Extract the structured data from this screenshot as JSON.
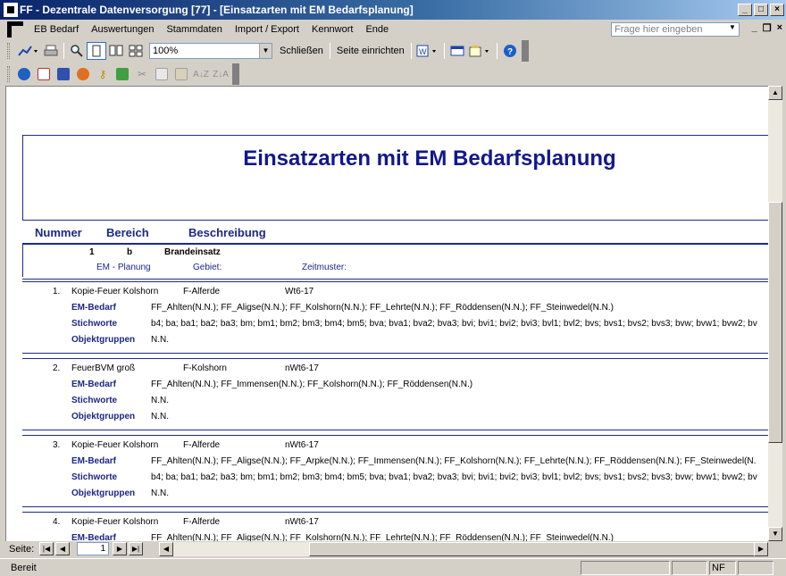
{
  "window": {
    "title": "FF - Dezentrale Datenversorgung [77] - [Einsatzarten mit EM Bedarfsplanung]",
    "controls": {
      "minimize": "_",
      "maximize": "□",
      "close": "×"
    }
  },
  "menubar": {
    "items": [
      "EB Bedarf",
      "Auswertungen",
      "Stammdaten",
      "Import / Export",
      "Kennwort",
      "Ende"
    ],
    "help_placeholder": "Frage hier eingeben",
    "mdi": {
      "minimize": "_",
      "restore": "❐",
      "close": "×"
    }
  },
  "toolbar1": {
    "zoom_value": "100%",
    "close_label": "Schließen",
    "page_setup_label": "Seite einrichten"
  },
  "report": {
    "title": "Einsatzarten mit EM Bedarfsplanung",
    "columns": {
      "nummer": "Nummer",
      "bereich": "Bereich",
      "beschreibung": "Beschreibung"
    },
    "group": {
      "nummer": "1",
      "bereich": "b",
      "beschreibung": "Brandeinsatz",
      "label_em_planung": "EM - Planung",
      "label_gebiet": "Gebiet:",
      "label_zeitmuster": "Zeitmuster:"
    },
    "labels": {
      "em_bedarf": "EM-Bedarf",
      "stichworte": "Stichworte",
      "objektgruppen": "Objektgruppen"
    },
    "entries": [
      {
        "nr": "1.",
        "name": "Kopie-Feuer Kolshorn",
        "gebiet": "F-Alferde",
        "zeitmuster": "Wt6-17",
        "em_bedarf": "FF_Ahlten(N.N.); FF_Aligse(N.N.); FF_Kolshorn(N.N.); FF_Lehrte(N.N.); FF_Röddensen(N.N.); FF_Steinwedel(N.N.)",
        "stichworte": "b4; ba; ba1; ba2; ba3; bm; bm1; bm2; bm3; bm4; bm5; bva; bva1; bva2; bva3; bvi; bvi1; bvi2; bvi3; bvl1; bvl2; bvs; bvs1; bvs2; bvs3; bvw; bvw1; bvw2; bv",
        "objektgruppen": "N.N."
      },
      {
        "nr": "2.",
        "name": "FeuerBVM groß",
        "gebiet": "F-Kolshorn",
        "zeitmuster": "nWt6-17",
        "em_bedarf": "FF_Ahlten(N.N.); FF_Immensen(N.N.); FF_Kolshorn(N.N.); FF_Röddensen(N.N.)",
        "stichworte": "N.N.",
        "objektgruppen": "N.N."
      },
      {
        "nr": "3.",
        "name": "Kopie-Feuer Kolshorn",
        "gebiet": "F-Alferde",
        "zeitmuster": "nWt6-17",
        "em_bedarf": "FF_Ahlten(N.N.); FF_Aligse(N.N.); FF_Arpke(N.N.); FF_Immensen(N.N.); FF_Kolshorn(N.N.); FF_Lehrte(N.N.); FF_Röddensen(N.N.); FF_Steinwedel(N.",
        "stichworte": "b4; ba; ba1; ba2; ba3; bm; bm1; bm2; bm3; bm4; bm5; bva; bva1; bva2; bva3; bvi; bvi1; bvi2; bvi3; bvl1; bvl2; bvs; bvs1; bvs2; bvs3; bvw; bvw1; bvw2; bv",
        "objektgruppen": "N.N."
      },
      {
        "nr": "4.",
        "name": "Kopie-Feuer Kolshorn",
        "gebiet": "F-Alferde",
        "zeitmuster": "nWt6-17",
        "em_bedarf": "FF_Ahlten(N.N.); FF_Aligse(N.N.); FF_Kolshorn(N.N.); FF_Lehrte(N.N.); FF_Röddensen(N.N.); FF_Steinwedel(N.N.)"
      }
    ]
  },
  "pager": {
    "label": "Seite:",
    "current_page": "1"
  },
  "status": {
    "text": "Bereit",
    "mode": "NF"
  }
}
